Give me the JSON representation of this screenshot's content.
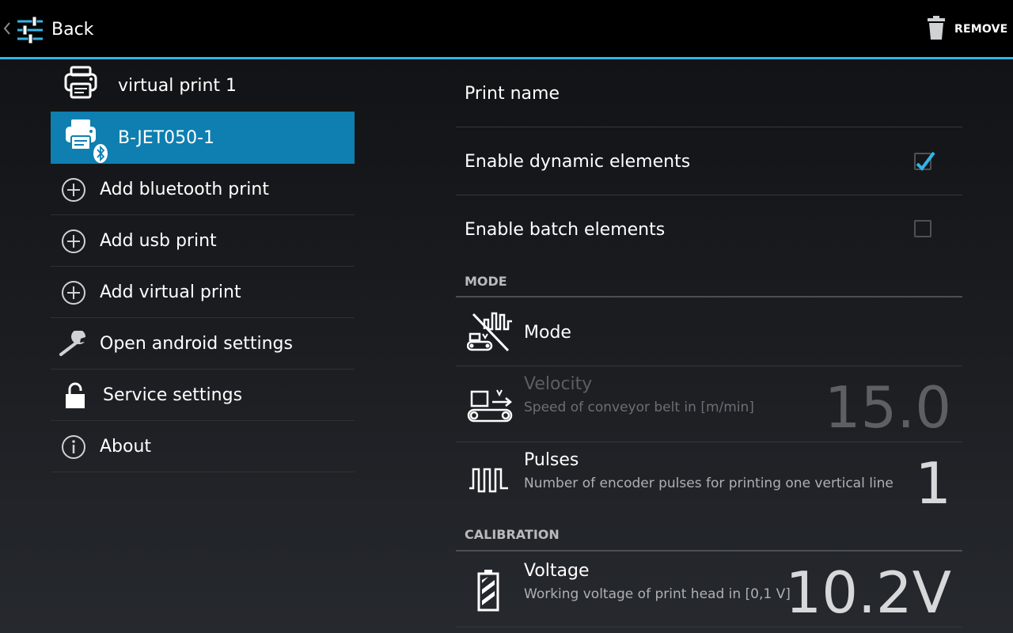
{
  "actionbar": {
    "back_label": "Back",
    "remove_label": "REMOVE",
    "accent_color": "#33b5e5"
  },
  "printers": [
    {
      "label": "virtual print 1",
      "icon": "printer-icon",
      "selected": false
    },
    {
      "label": "B-JET050-1",
      "icon": "bluetooth-printer-icon",
      "selected": true
    }
  ],
  "menu": [
    {
      "label": "Add bluetooth print",
      "icon": "add-circle-icon"
    },
    {
      "label": "Add usb print",
      "icon": "add-circle-icon"
    },
    {
      "label": "Add virtual print",
      "icon": "add-circle-icon"
    },
    {
      "label": "Open android settings",
      "icon": "wrench-icon"
    },
    {
      "label": "Service settings",
      "icon": "lock-icon"
    },
    {
      "label": "About",
      "icon": "info-icon"
    }
  ],
  "settings": {
    "print_name": {
      "title": "Print name"
    },
    "dynamic": {
      "title": "Enable dynamic elements",
      "checked": true
    },
    "batch": {
      "title": "Enable batch elements",
      "checked": false
    },
    "mode_category": "MODE",
    "mode": {
      "title": "Mode",
      "icon": "mode-disabled-icon"
    },
    "velocity": {
      "title": "Velocity",
      "summary": "Speed of conveyor belt in [m/min]",
      "value": "15.0",
      "icon": "conveyor-icon",
      "enabled": false
    },
    "pulses": {
      "title": "Pulses",
      "summary": "Number of encoder pulses for printing one vertical line",
      "value": "1",
      "icon": "pulse-icon"
    },
    "calibration_category": "CALIBRATION",
    "voltage": {
      "title": "Voltage",
      "summary": "Working voltage of print head in [0,1 V]",
      "value": "10.2V",
      "icon": "battery-icon"
    }
  }
}
